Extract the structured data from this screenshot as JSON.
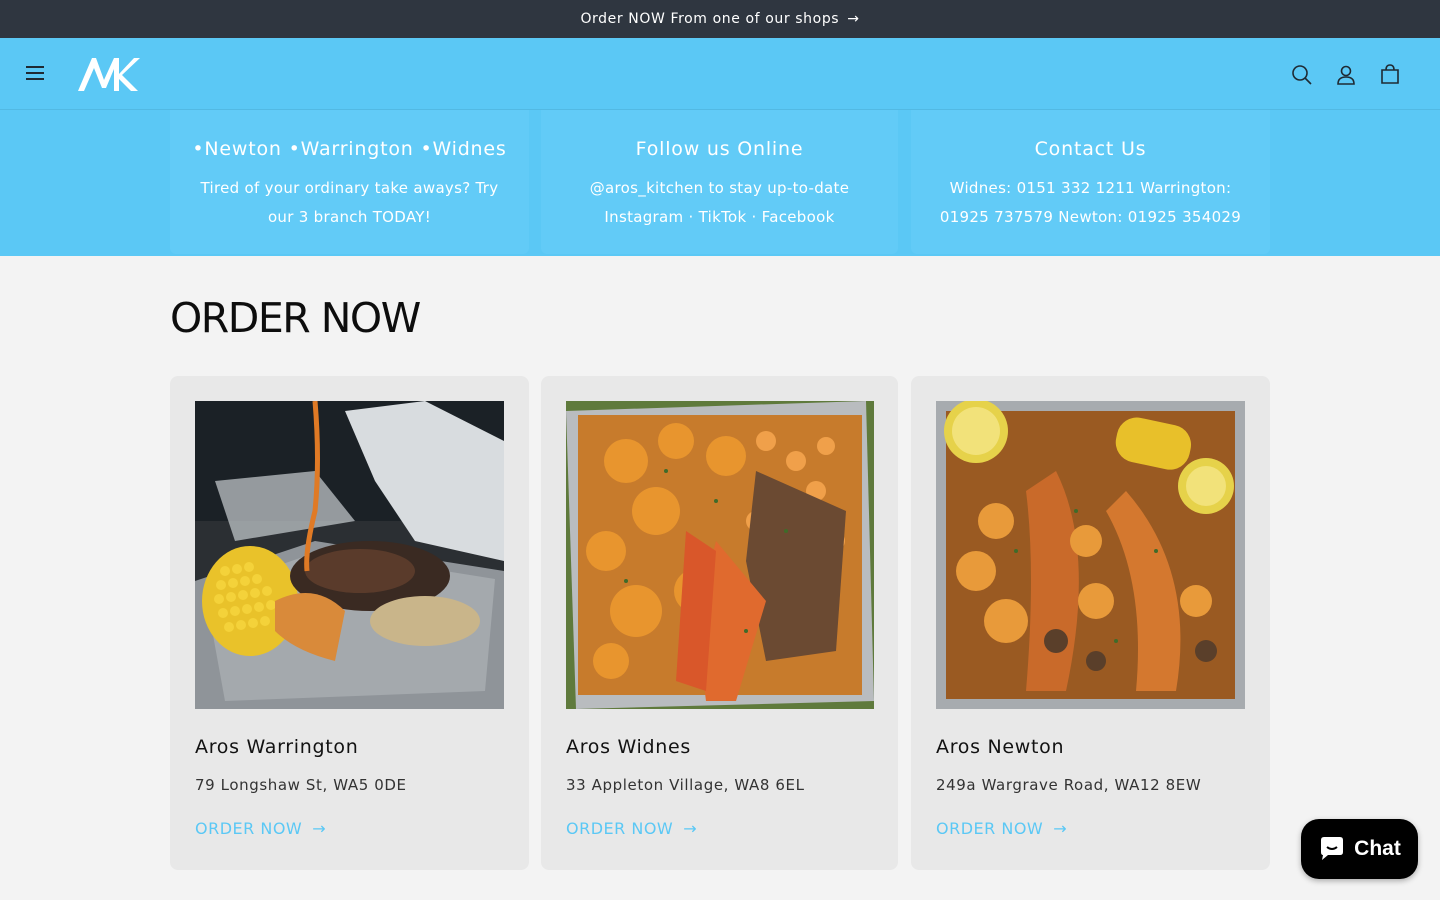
{
  "announcement": {
    "text": "Order NOW From one of our shops",
    "arrow": "→"
  },
  "header": {
    "logo_text": "AK",
    "icons": [
      "menu-icon",
      "search-icon",
      "account-icon",
      "cart-icon"
    ]
  },
  "features": [
    {
      "title": "•Newton •Warrington •Widnes",
      "text": "Tired of your ordinary take aways? Try our 3 branch TODAY!"
    },
    {
      "title": "Follow us Online",
      "text": "@aros_kitchen to stay up-to-date Instagram · TikTok · Facebook"
    },
    {
      "title": "Contact Us",
      "text": "Widnes: 0151 332 1211 Warrington: 01925 737579 Newton: 01925 354029"
    }
  ],
  "section": {
    "title": "ORDER NOW"
  },
  "cards": [
    {
      "name": "Aros Warrington",
      "address": "79 Longshaw St, WA5 0DE",
      "cta": "ORDER NOW",
      "arrow": "→"
    },
    {
      "name": "Aros Widnes",
      "address": "33 Appleton Village, WA8 6EL",
      "cta": "ORDER NOW",
      "arrow": "→"
    },
    {
      "name": "Aros Newton",
      "address": "249a Wargrave Road, WA12 8EW",
      "cta": "ORDER NOW",
      "arrow": "→"
    }
  ],
  "chat": {
    "label": "Chat"
  },
  "colors": {
    "accent": "#5bc8f5",
    "announcement_bg": "#2f3640",
    "page_bg": "#f3f3f3",
    "card_bg": "#e8e8e8"
  }
}
